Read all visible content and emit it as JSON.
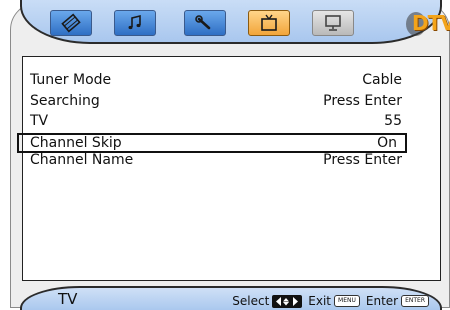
{
  "tabs": [
    {
      "name": "picture",
      "icon": "film-strip-icon"
    },
    {
      "name": "sound",
      "icon": "music-note-icon"
    },
    {
      "name": "setup",
      "icon": "wrench-icon"
    },
    {
      "name": "tv",
      "icon": "tv-icon",
      "active": true
    },
    {
      "name": "pc",
      "icon": "monitor-icon"
    }
  ],
  "logo": {
    "text": "DTV"
  },
  "menu": {
    "items": [
      {
        "label": "Tuner Mode",
        "value": "Cable"
      },
      {
        "label": "Searching",
        "value": "Press Enter"
      },
      {
        "label": "TV",
        "value": "55"
      },
      {
        "label": "Channel Skip",
        "value": "On",
        "selected": true
      },
      {
        "label": "Channel Name",
        "value": "Press Enter"
      }
    ]
  },
  "footer": {
    "title": "TV",
    "select_label": "Select",
    "exit_label": "Exit",
    "menu_key": "MENU",
    "enter_label": "Enter",
    "enter_key": "ENTER"
  },
  "colors": {
    "tab_active": "#f2a53a",
    "tab_inactive": "#2f6fc4",
    "bar_bg": "#aac8ee",
    "logo": "#f3a41a"
  }
}
